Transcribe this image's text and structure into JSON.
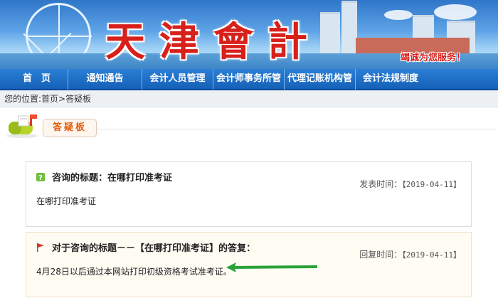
{
  "banner": {
    "title": "天津會計",
    "slogan": "竭诚为您服务！"
  },
  "nav": {
    "items": [
      "首　页",
      "通知通告",
      "会计人员管理",
      "会计师事务所管",
      "代理记账机构管",
      "会计法规制度"
    ]
  },
  "breadcrumb": {
    "text": "您的位置:首页>答疑板"
  },
  "section": {
    "tag": "答疑板"
  },
  "question": {
    "title": "咨询的标题：在哪打印准考证",
    "date_label": "发表时间：",
    "date": "【2019-04-11】",
    "body": "在哪打印准考证"
  },
  "answer": {
    "title": "对于咨询的标题－－【在哪打印准考证】的答复：",
    "date_label": "回复时间：",
    "date": "【2019-04-11】",
    "body": "4月28日以后通过本网站打印初级资格考试准考证。"
  },
  "colors": {
    "nav": "#1f6fc6",
    "title_red": "#d8201a",
    "tag_orange": "#e06010",
    "arrow_green": "#2aa23a"
  }
}
